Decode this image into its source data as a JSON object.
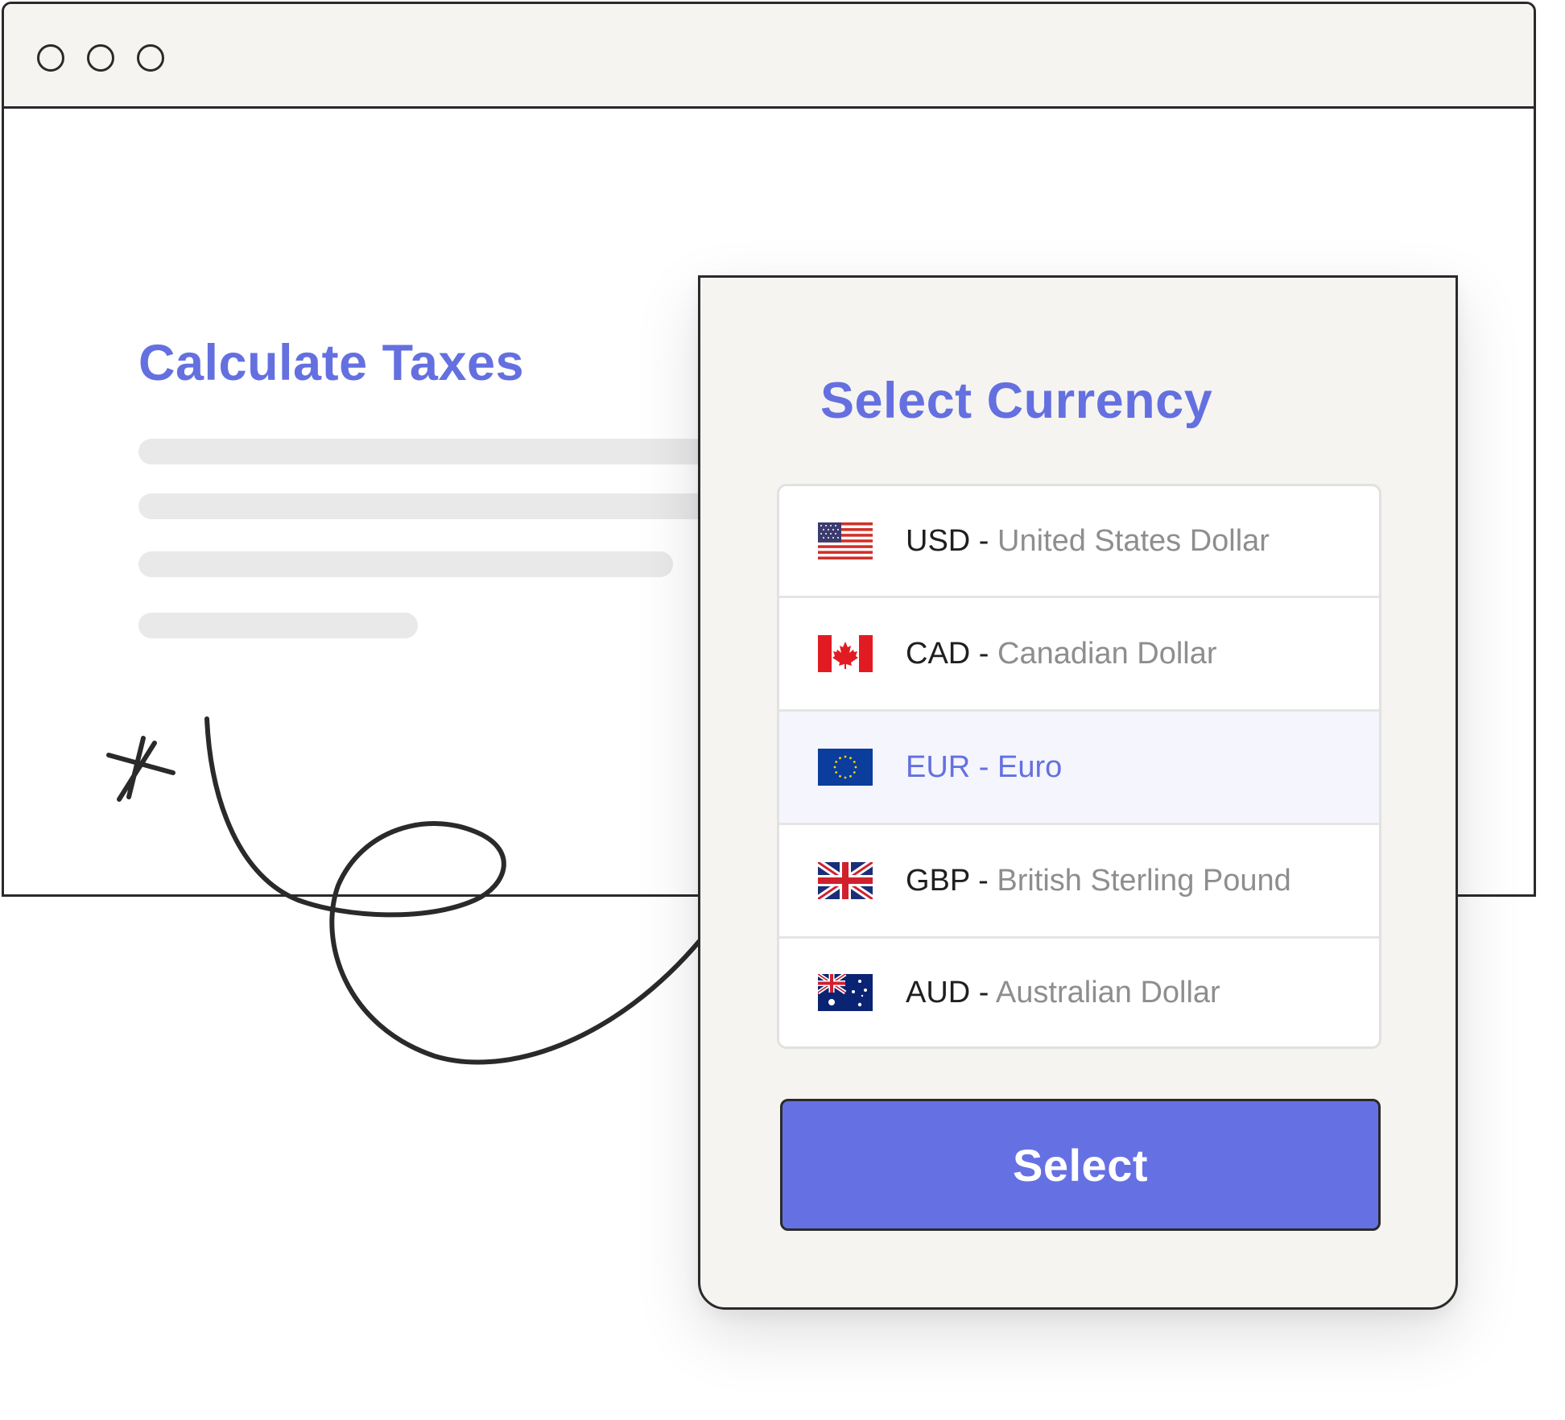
{
  "browser": {
    "window_controls": [
      "circle-icon",
      "circle-icon",
      "circle-icon"
    ]
  },
  "page": {
    "title": "Calculate Taxes"
  },
  "modal": {
    "title": "Select Currency",
    "selected_code": "EUR",
    "currencies": [
      {
        "flag": "us-flag-icon",
        "code": "USD",
        "separator": " - ",
        "name": "United States Dollar"
      },
      {
        "flag": "canada-flag-icon",
        "code": "CAD",
        "separator": " - ",
        "name": "Canadian Dollar"
      },
      {
        "flag": "eu-flag-icon",
        "code": "EUR",
        "separator": " - ",
        "name": "Euro"
      },
      {
        "flag": "uk-flag-icon",
        "code": "GBP",
        "separator": " - ",
        "name": "British Sterling Pound"
      },
      {
        "flag": "australia-flag-icon",
        "code": "AUD",
        "separator": " - ",
        "name": "Australian Dollar"
      }
    ],
    "button_label": "Select"
  },
  "colors": {
    "accent": "#6470e0",
    "button": "#6571e3",
    "selected_row": "#f4f5fd",
    "panel": "#f6f4f1"
  }
}
